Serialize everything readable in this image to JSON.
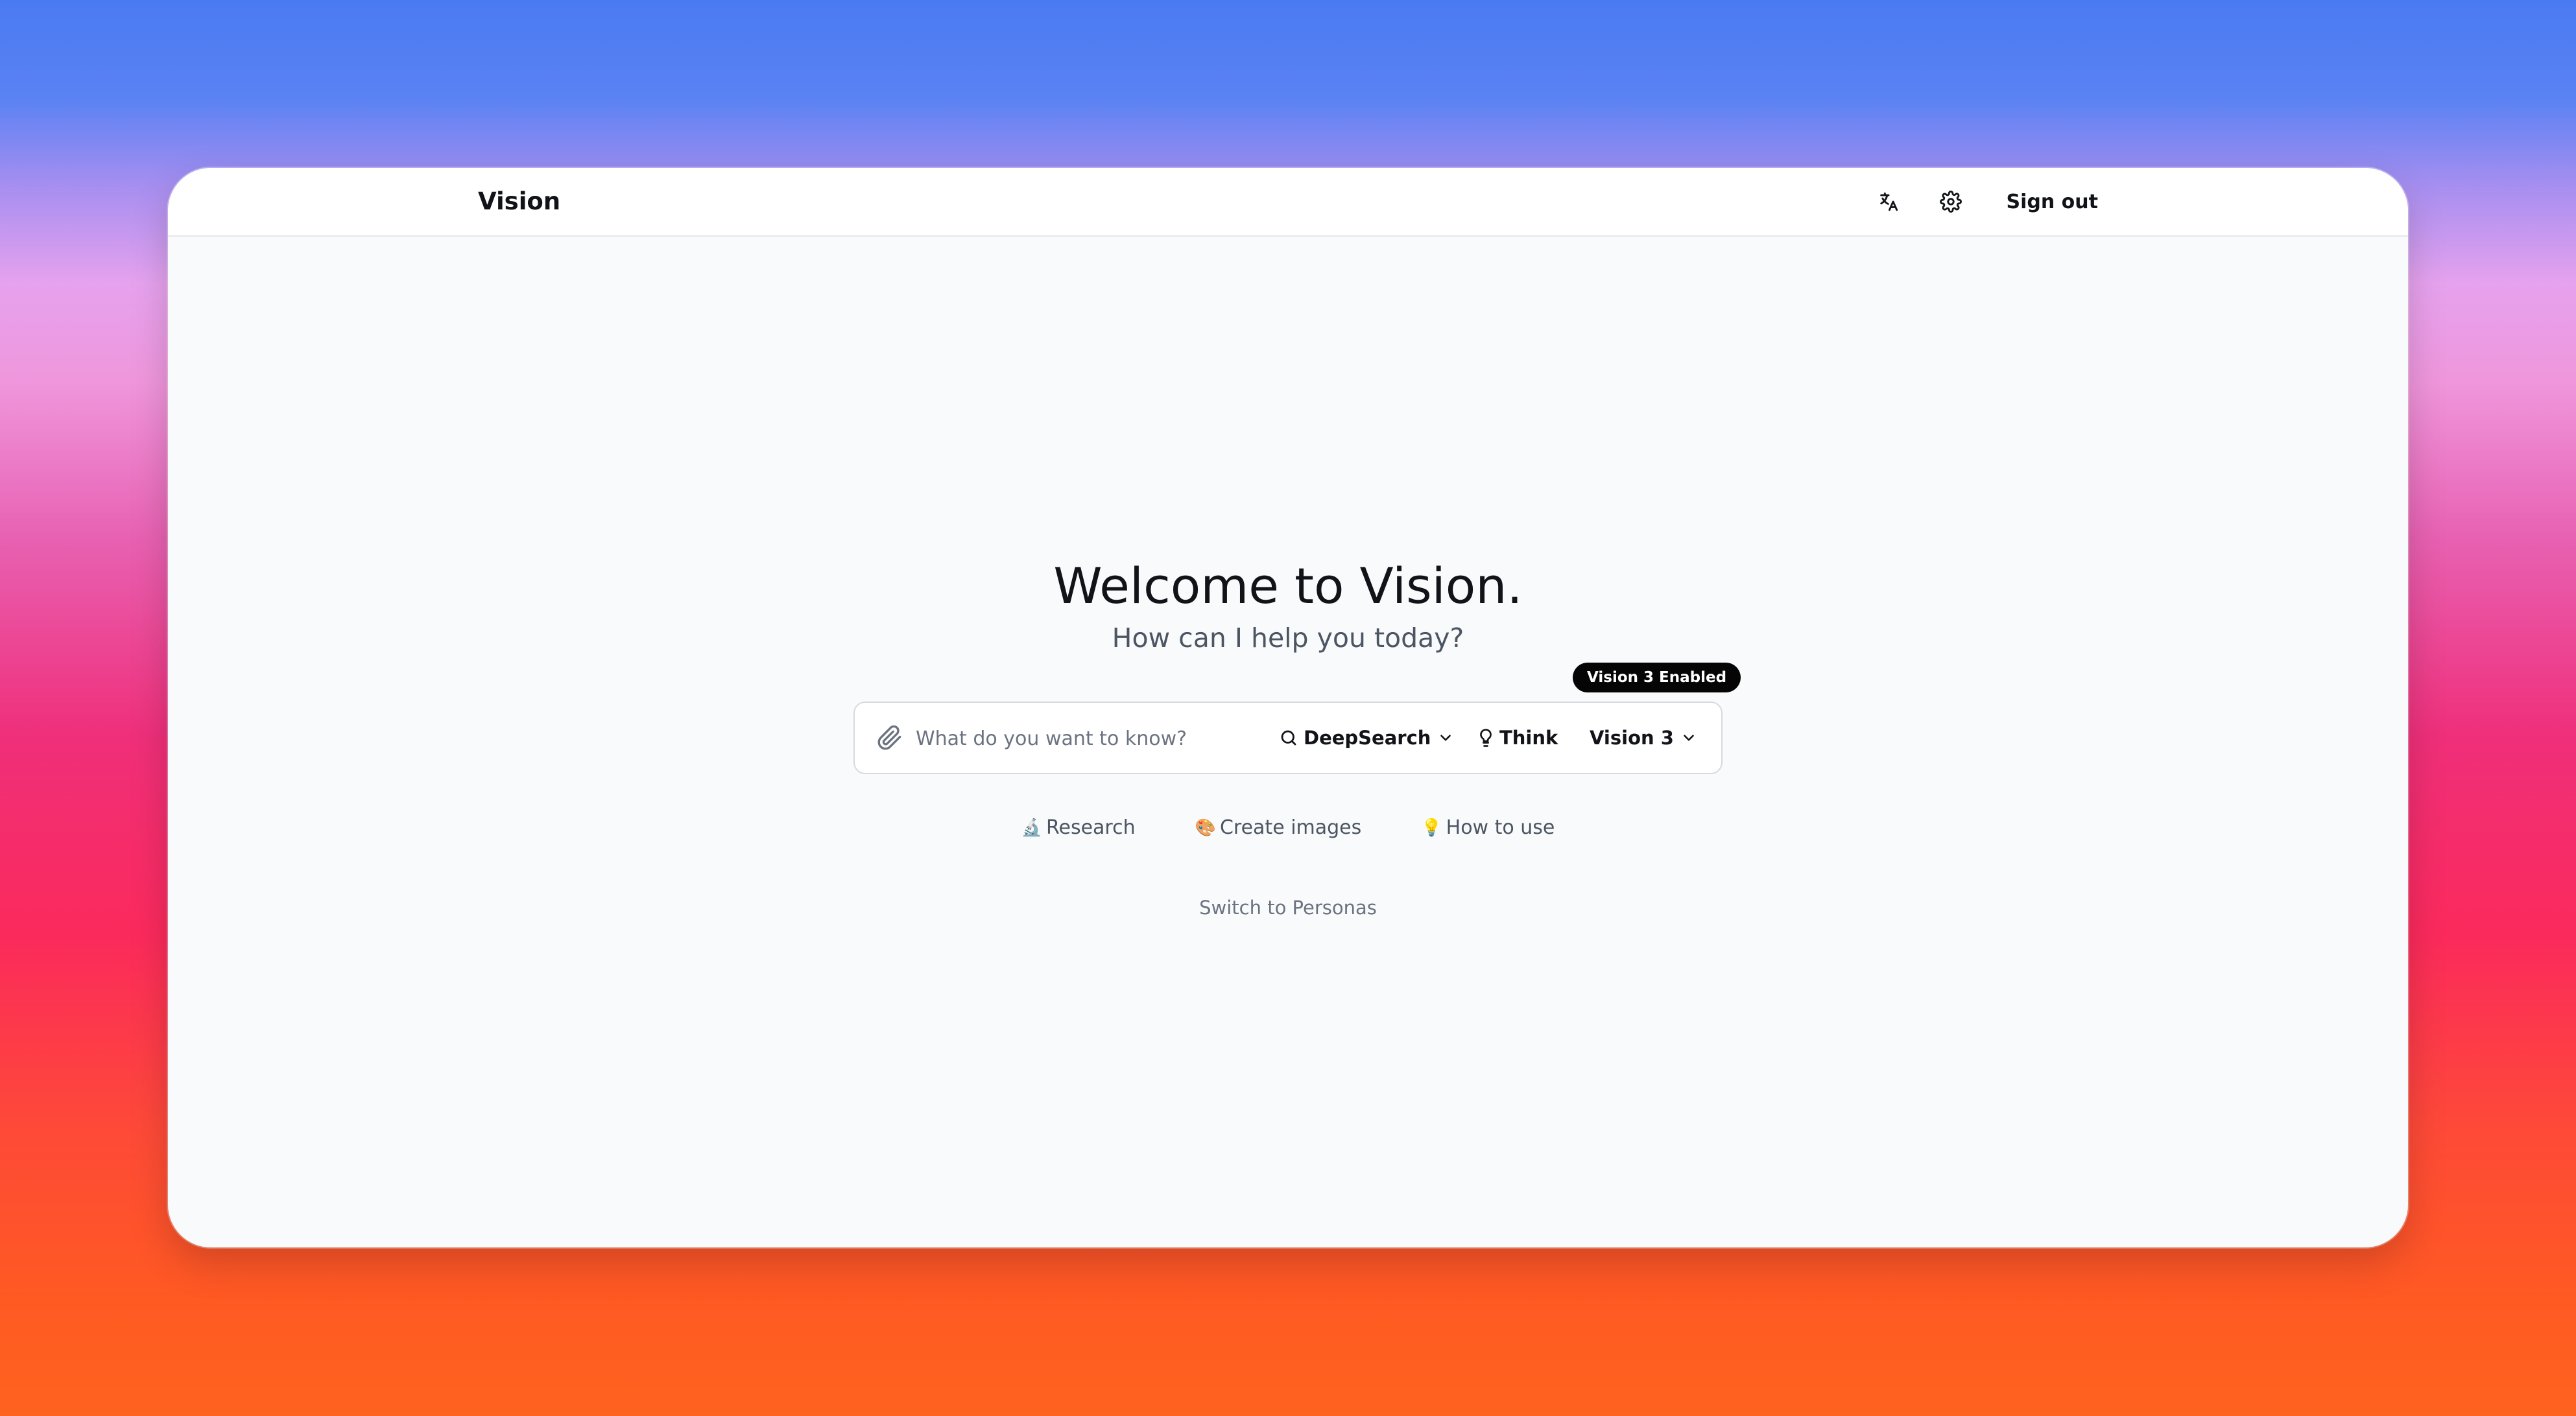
{
  "app": {
    "brand": "Vision"
  },
  "nav": {
    "translate_icon": "translate-icon",
    "settings_icon": "gear-icon",
    "sign_out_label": "Sign out"
  },
  "hero": {
    "title": "Welcome to Vision.",
    "subtitle": "How can I help you today?"
  },
  "badge": {
    "label": "Vision 3 Enabled"
  },
  "composer": {
    "attach_icon": "paperclip-icon",
    "input_value": "",
    "placeholder": "What do you want to know?",
    "search_mode": {
      "icon": "search-icon",
      "label": "DeepSearch",
      "dropdown_icon": "chevron-down-icon"
    },
    "think": {
      "icon": "lightbulb-icon",
      "label": "Think"
    },
    "model": {
      "label": "Vision 3",
      "dropdown_icon": "chevron-down-icon"
    }
  },
  "suggestions": [
    {
      "emoji": "🔬",
      "label": "Research"
    },
    {
      "emoji": "🎨",
      "label": "Create images"
    },
    {
      "emoji": "💡",
      "label": "How to use"
    }
  ],
  "switch_link": "Switch to Personas",
  "colors": {
    "badge_background": "#050505",
    "text_primary": "#111318",
    "text_muted": "#4b5563",
    "window_background": "#f9fafb"
  }
}
